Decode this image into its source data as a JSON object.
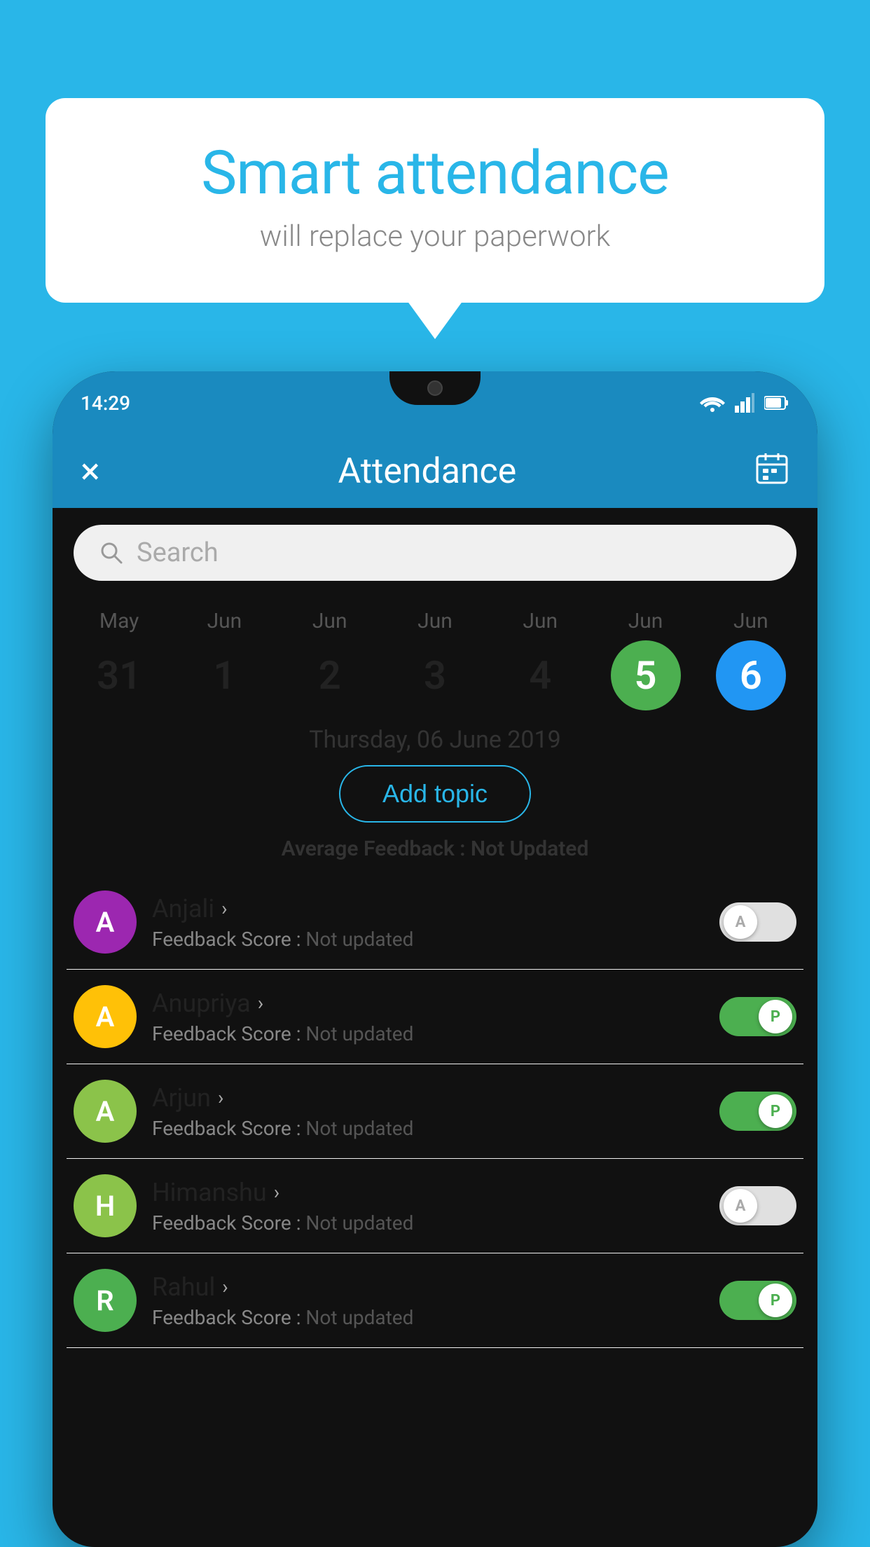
{
  "background_color": "#29b6e8",
  "bubble": {
    "title": "Smart attendance",
    "subtitle": "will replace your paperwork"
  },
  "phone": {
    "status_time": "14:29",
    "header": {
      "title": "Attendance",
      "close_label": "×",
      "calendar_label": "📅"
    },
    "search": {
      "placeholder": "Search"
    },
    "calendar": {
      "days": [
        {
          "month": "May",
          "date": "31",
          "style": "normal"
        },
        {
          "month": "Jun",
          "date": "1",
          "style": "normal"
        },
        {
          "month": "Jun",
          "date": "2",
          "style": "normal"
        },
        {
          "month": "Jun",
          "date": "3",
          "style": "normal"
        },
        {
          "month": "Jun",
          "date": "4",
          "style": "normal"
        },
        {
          "month": "Jun",
          "date": "5",
          "style": "today"
        },
        {
          "month": "Jun",
          "date": "6",
          "style": "selected"
        }
      ]
    },
    "selected_date": "Thursday, 06 June 2019",
    "add_topic_label": "Add topic",
    "avg_feedback_label": "Average Feedback :",
    "avg_feedback_value": "Not Updated",
    "students": [
      {
        "name": "Anjali",
        "avatar_letter": "A",
        "avatar_color": "#9c27b0",
        "feedback_label": "Feedback Score :",
        "feedback_value": "Not updated",
        "toggle": "off",
        "toggle_label": "A"
      },
      {
        "name": "Anupriya",
        "avatar_letter": "A",
        "avatar_color": "#ffc107",
        "feedback_label": "Feedback Score :",
        "feedback_value": "Not updated",
        "toggle": "on",
        "toggle_label": "P"
      },
      {
        "name": "Arjun",
        "avatar_letter": "A",
        "avatar_color": "#8bc34a",
        "feedback_label": "Feedback Score :",
        "feedback_value": "Not updated",
        "toggle": "on",
        "toggle_label": "P"
      },
      {
        "name": "Himanshu",
        "avatar_letter": "H",
        "avatar_color": "#8bc34a",
        "feedback_label": "Feedback Score :",
        "feedback_value": "Not updated",
        "toggle": "off",
        "toggle_label": "A"
      },
      {
        "name": "Rahul",
        "avatar_letter": "R",
        "avatar_color": "#4caf50",
        "feedback_label": "Feedback Score :",
        "feedback_value": "Not updated",
        "toggle": "on",
        "toggle_label": "P"
      }
    ]
  }
}
